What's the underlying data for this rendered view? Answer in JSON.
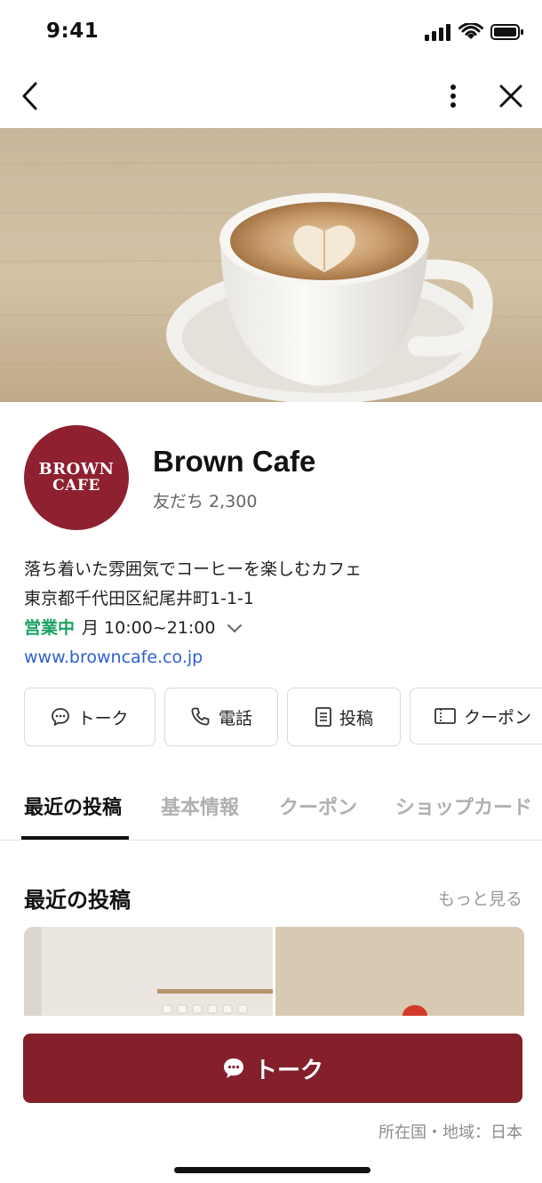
{
  "status_bar": {
    "time": "9:41"
  },
  "profile": {
    "logo_line1": "BROWN",
    "logo_line2": "CAFE",
    "name": "Brown Cafe",
    "friends": "友だち 2,300"
  },
  "info": {
    "description": "落ち着いた雰囲気でコーヒーを楽しむカフェ",
    "address": "東京都千代田区紀尾井町1-1-1",
    "status": "営業中",
    "hours": "月 10:00~21:00",
    "website": "www.browncafe.co.jp"
  },
  "actions": [
    {
      "label": "トーク",
      "icon": "chat-bubble-icon"
    },
    {
      "label": "電話",
      "icon": "phone-icon"
    },
    {
      "label": "投稿",
      "icon": "document-icon"
    },
    {
      "label": "クーポン",
      "icon": "ticket-icon"
    }
  ],
  "tabs": [
    "最近の投稿",
    "基本情報",
    "クーポン",
    "ショップカード"
  ],
  "recent_posts": {
    "title": "最近の投稿",
    "more": "もっと見る"
  },
  "cta": {
    "label": "トーク"
  },
  "footer": {
    "country": "所在国・地域：日本"
  },
  "colors": {
    "brand": "#83202a",
    "open_status": "#1aa260",
    "link": "#2f5fd0"
  }
}
